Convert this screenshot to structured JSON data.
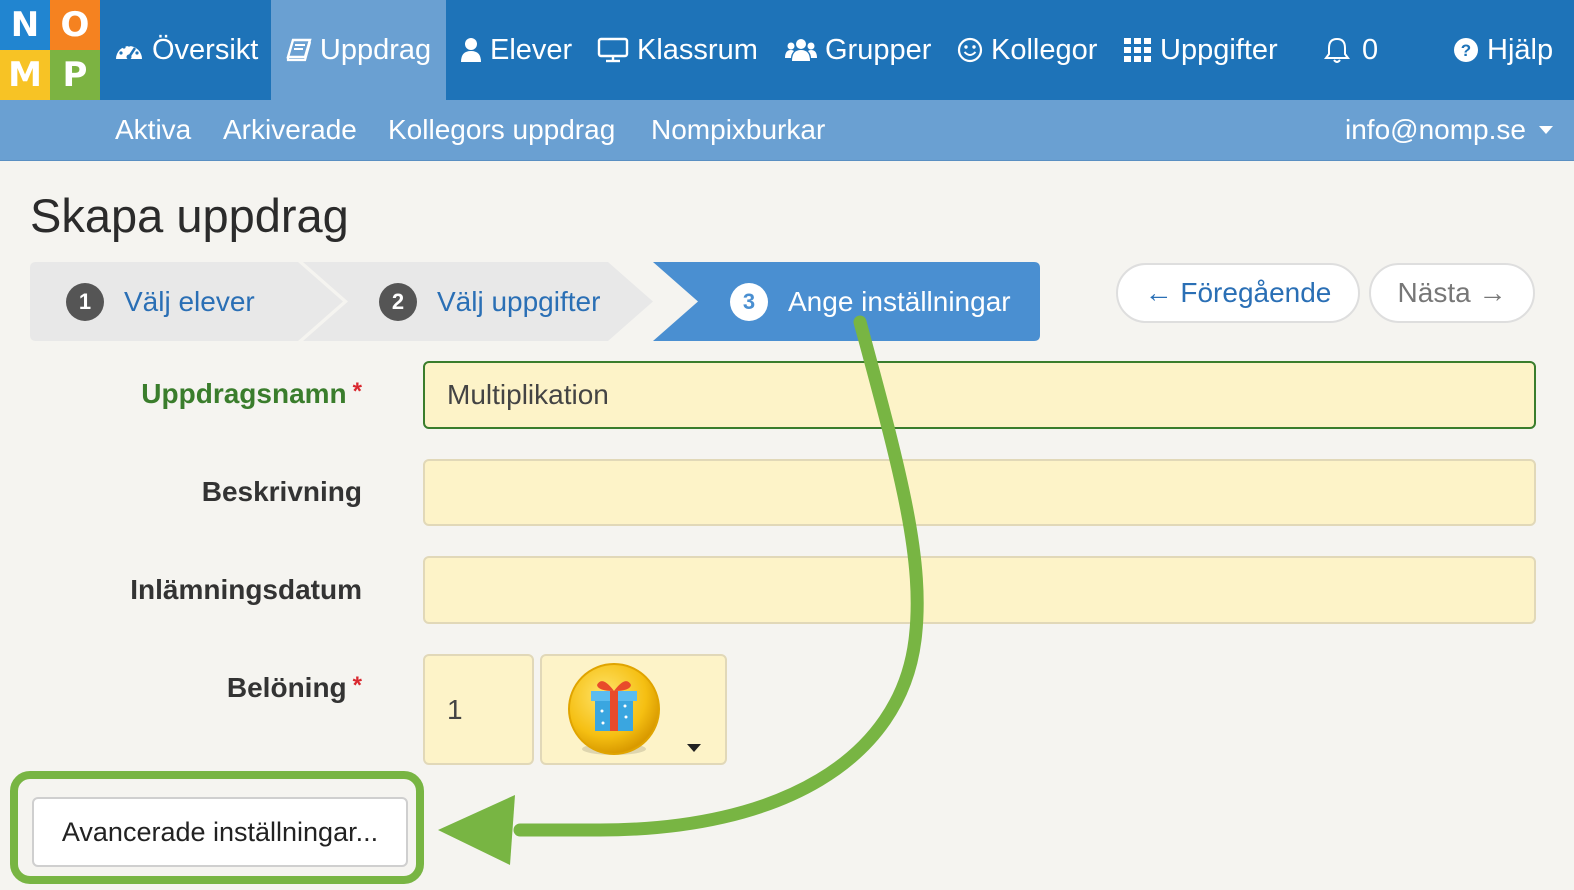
{
  "logo": {
    "letters": [
      "N",
      "O",
      "M",
      "P"
    ],
    "colors": [
      "#2185d0",
      "#f58220",
      "#f7c325",
      "#7cb342"
    ]
  },
  "topnav": {
    "items": [
      {
        "label": "Översikt",
        "icon": "dashboard-icon"
      },
      {
        "label": "Uppdrag",
        "icon": "book-icon",
        "active": true
      },
      {
        "label": "Elever",
        "icon": "user-icon"
      },
      {
        "label": "Klassrum",
        "icon": "monitor-icon"
      },
      {
        "label": "Grupper",
        "icon": "users-icon"
      },
      {
        "label": "Kollegor",
        "icon": "smile-icon"
      },
      {
        "label": "Uppgifter",
        "icon": "grid-icon"
      }
    ],
    "notifications": "0",
    "help": "Hjälp"
  },
  "subnav": {
    "items": [
      "Aktiva",
      "Arkiverade",
      "Kollegors uppdrag",
      "Nompixburkar"
    ],
    "account": "info@nomp.se"
  },
  "page": {
    "title": "Skapa uppdrag"
  },
  "wizard": {
    "steps": [
      {
        "num": "1",
        "label": "Välj elever"
      },
      {
        "num": "2",
        "label": "Välj uppgifter"
      },
      {
        "num": "3",
        "label": "Ange inställningar",
        "active": true
      }
    ],
    "prev": "← Föregående",
    "next": "Nästa →"
  },
  "form": {
    "name_label": "Uppdragsnamn",
    "name_value": "Multiplikation",
    "description_label": "Beskrivning",
    "description_value": "",
    "date_label": "Inlämningsdatum",
    "date_value": "",
    "reward_label": "Belöning",
    "reward_count": "1",
    "reward_icon": "gift-icon",
    "required_mark": "*"
  },
  "advanced_button": "Avancerade inställningar...",
  "colors": {
    "primary": "#1e73b8",
    "secondary": "#6aa0d2",
    "highlight": "#78b543",
    "field": "#fdf3c8"
  }
}
